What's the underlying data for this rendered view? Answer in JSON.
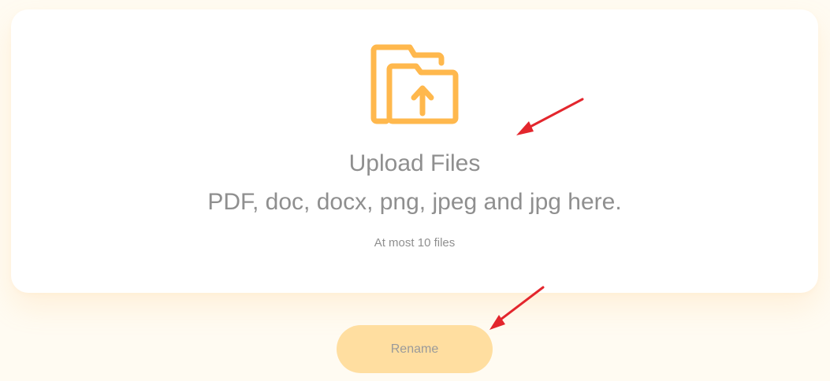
{
  "upload": {
    "icon": "folder-upload-icon",
    "title": "Upload Files",
    "subtitle": "PDF, doc, docx, png, jpeg and jpg here.",
    "limit": "At most 10 files"
  },
  "actions": {
    "rename_label": "Rename"
  },
  "colors": {
    "accent": "#ffb84d",
    "button_bg": "#ffdea0",
    "annotation": "#e3262d",
    "text_muted": "#8f8f8f",
    "page_bg": "#fffbf2"
  }
}
